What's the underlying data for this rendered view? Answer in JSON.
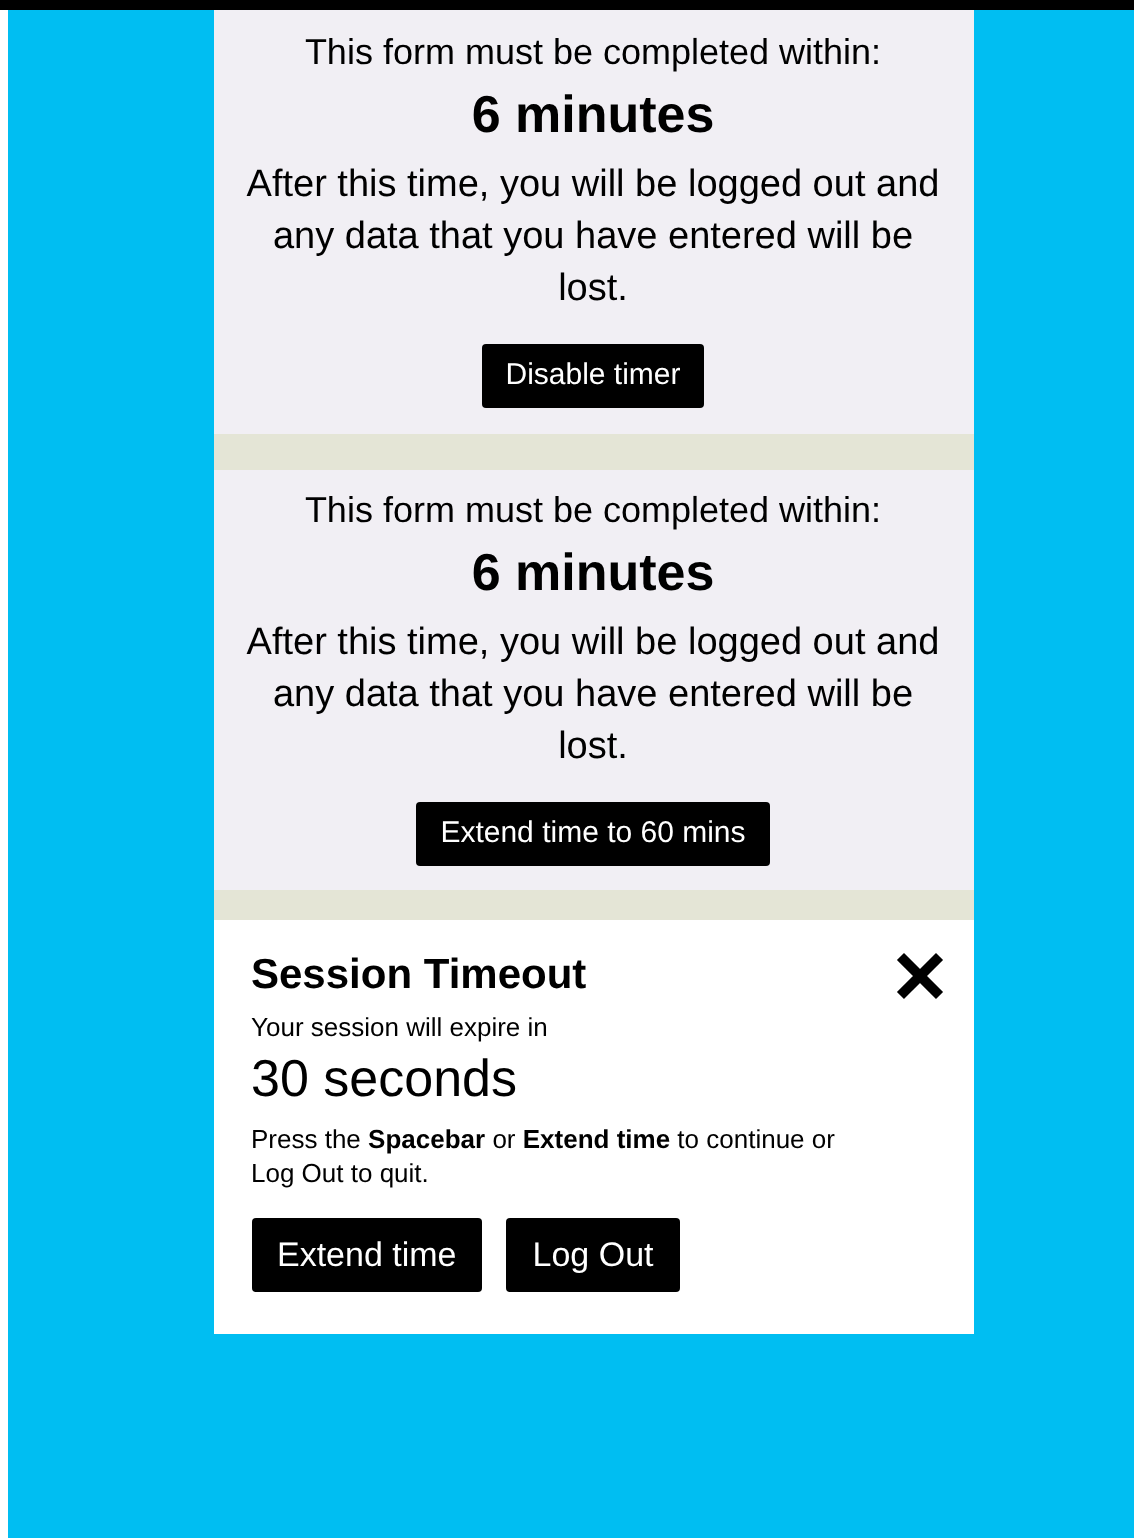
{
  "panels": [
    {
      "intro": "This form must be completed within:",
      "duration": "6 minutes",
      "warning": "After this time, you will be logged out and any data that you have entered will be lost.",
      "button": "Disable timer"
    },
    {
      "intro": "This form must be completed within:",
      "duration": "6 minutes",
      "warning": "After this time, you will be logged out and any data that you have entered will be lost.",
      "button": "Extend time to 60 mins"
    }
  ],
  "dialog": {
    "title": "Session Timeout",
    "message": "Your session will expire in",
    "countdown": "30 seconds",
    "instructions": "Press the **Spacebar** or **Extend time** to continue or Log Out to quit.",
    "buttons": [
      "Extend time",
      "Log Out"
    ]
  }
}
